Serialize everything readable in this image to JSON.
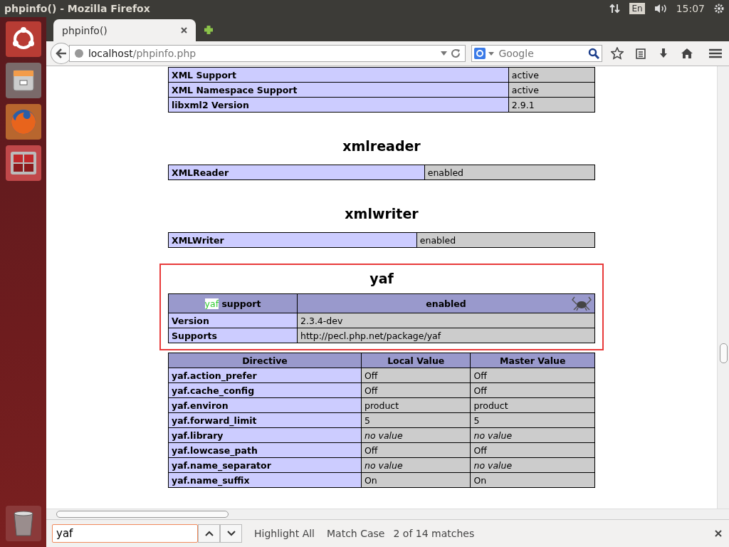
{
  "top_bar": {
    "title": "phpinfo() - Mozilla Firefox",
    "keyboard": "En",
    "time": "15:07"
  },
  "tabs": [
    {
      "label": "phpinfo()",
      "selected": true
    }
  ],
  "address": {
    "host": "localhost",
    "path": "/phpinfo.php"
  },
  "search": {
    "placeholder": "Google"
  },
  "sections": [
    {
      "rows": [
        [
          "XML Support",
          "active"
        ],
        [
          "XML Namespace Support",
          "active"
        ],
        [
          "libxml2 Version",
          "2.9.1"
        ]
      ]
    },
    {
      "title": "xmlreader",
      "rows": [
        [
          "XMLReader",
          "enabled"
        ]
      ]
    },
    {
      "title": "xmlwriter",
      "rows": [
        [
          "XMLWriter",
          "enabled"
        ]
      ]
    }
  ],
  "yaf": {
    "title": "yaf",
    "header_match": "yaf",
    "header_label": "support",
    "header_value": "enabled",
    "rows": [
      [
        "Version",
        "2.3.4-dev"
      ],
      [
        "Supports",
        "http://pecl.php.net/package/yaf"
      ]
    ]
  },
  "directives": {
    "columns": [
      "Directive",
      "Local Value",
      "Master Value"
    ],
    "rows": [
      {
        "name": "yaf.action_prefer",
        "local": "Off",
        "master": "Off",
        "no_value": false
      },
      {
        "name": "yaf.cache_config",
        "local": "Off",
        "master": "Off",
        "no_value": false
      },
      {
        "name": "yaf.environ",
        "local": "product",
        "master": "product",
        "no_value": false
      },
      {
        "name": "yaf.forward_limit",
        "local": "5",
        "master": "5",
        "no_value": false
      },
      {
        "name": "yaf.library",
        "local": "no value",
        "master": "no value",
        "no_value": true
      },
      {
        "name": "yaf.lowcase_path",
        "local": "Off",
        "master": "Off",
        "no_value": false
      },
      {
        "name": "yaf.name_separator",
        "local": "no value",
        "master": "no value",
        "no_value": true
      },
      {
        "name": "yaf.name_suffix",
        "local": "On",
        "master": "On",
        "no_value": false
      }
    ]
  },
  "find_bar": {
    "value": "yaf",
    "highlight_all": "Highlight All",
    "match_case": "Match Case",
    "status": "2 of 14 matches"
  }
}
